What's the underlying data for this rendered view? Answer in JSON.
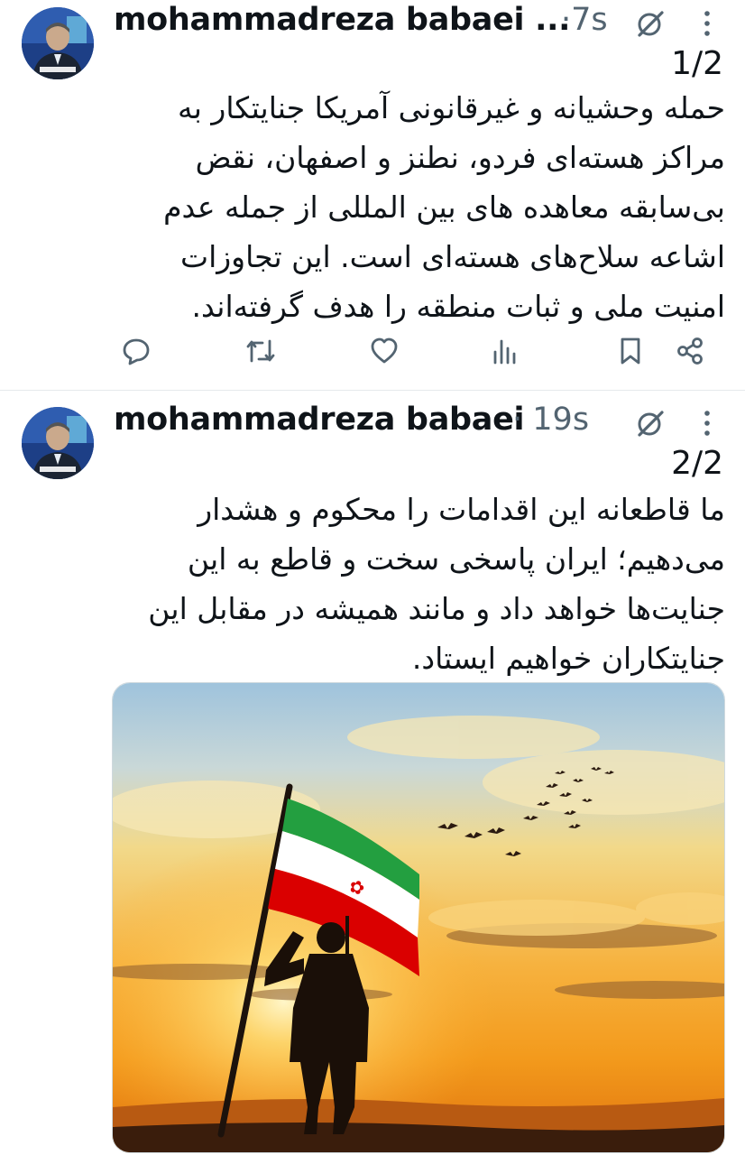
{
  "posts": [
    {
      "author": "mohammadreza babaei ...",
      "separator": "·",
      "time": "7s",
      "thread": "1/2",
      "text": "حمله وحشیانه و غیرقانونی آمریکا جنایتکار به مراکز هسته‌ای فردو، نطنز و اصفهان، نقض بی‌سابقه معاهده های بین المللی از جمله عدم اشاعه سلاح‌های هسته‌ای است. این تجاوزات امنیت ملی و ثبات منطقه را هدف گرفته‌اند.",
      "actions": [
        "reply-icon",
        "repost-icon",
        "like-icon",
        "views-icon",
        "bookmark-icon",
        "share-icon"
      ]
    },
    {
      "author": "mohammadreza babaei",
      "separator": "·",
      "time": "19s",
      "thread": "2/2",
      "text": "ما قاطعانه این اقدامات را محکوم و هشدار می‌دهیم؛ ایران پاسخی سخت و قاطع به این جنایت‌ها خواهد داد و مانند همیشه در مقابل این جنایتکاران خواهیم ایستاد."
    }
  ],
  "colors": {
    "text": "#0f1419",
    "secondary": "#536471",
    "flag_green": "#239f40",
    "flag_red": "#da0000"
  }
}
